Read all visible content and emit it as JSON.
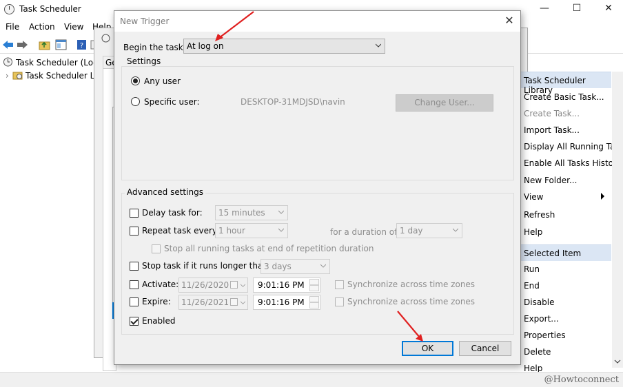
{
  "main_window": {
    "title": "Task Scheduler",
    "controls": {
      "minimize": "—",
      "maximize": "☐",
      "close": "✕"
    },
    "menu": [
      "File",
      "Action",
      "View",
      "Help"
    ],
    "tree": {
      "root": "Task Scheduler (Local)",
      "child": "Task Scheduler Library"
    },
    "background_tab": "Ge"
  },
  "actions_pane": {
    "section1_title": "Task Scheduler Library",
    "items1": [
      {
        "label": "Create Basic Task...",
        "disabled": false
      },
      {
        "label": "Create Task...",
        "disabled": true
      },
      {
        "label": "Import Task...",
        "disabled": false
      },
      {
        "label": "Display All Running Tasks",
        "disabled": false
      },
      {
        "label": "Enable All Tasks History",
        "disabled": false
      },
      {
        "label": "New Folder...",
        "disabled": false
      },
      {
        "label": "View",
        "disabled": false
      },
      {
        "label": "Refresh",
        "disabled": false
      },
      {
        "label": "Help",
        "disabled": false
      }
    ],
    "section2_title": "Selected Item",
    "items2": [
      "Run",
      "End",
      "Disable",
      "Export...",
      "Properties",
      "Delete",
      "Help"
    ]
  },
  "dialog": {
    "title": "New Trigger",
    "close_glyph": "✕",
    "begin_label": "Begin the task:",
    "begin_value": "At log on",
    "settings": {
      "title": "Settings",
      "any_user": "Any user",
      "specific_user": "Specific user:",
      "user_value": "DESKTOP-31MDJSD\\navin",
      "change_user_button": "Change User..."
    },
    "advanced": {
      "title": "Advanced settings",
      "delay_label": "Delay task for:",
      "delay_value": "15 minutes",
      "repeat_label": "Repeat task every:",
      "repeat_value": "1 hour",
      "duration_label": "for a duration of:",
      "duration_value": "1 day",
      "stop_running_label": "Stop all running tasks at end of repetition duration",
      "stop_longer_label": "Stop task if it runs longer than:",
      "stop_longer_value": "3 days",
      "activate_label": "Activate:",
      "activate_date": "11/26/2020",
      "activate_time": "9:01:16 PM",
      "expire_label": "Expire:",
      "expire_date": "11/26/2021",
      "expire_time": "9:01:16 PM",
      "sync_label": "Synchronize across time zones",
      "enabled_label": "Enabled",
      "enabled_checked": true
    },
    "ok_button": "OK",
    "cancel_button": "Cancel"
  },
  "watermark": "@Howtoconnect",
  "colors": {
    "annotation_arrow": "#e02020",
    "focus_border": "#0078d7"
  }
}
